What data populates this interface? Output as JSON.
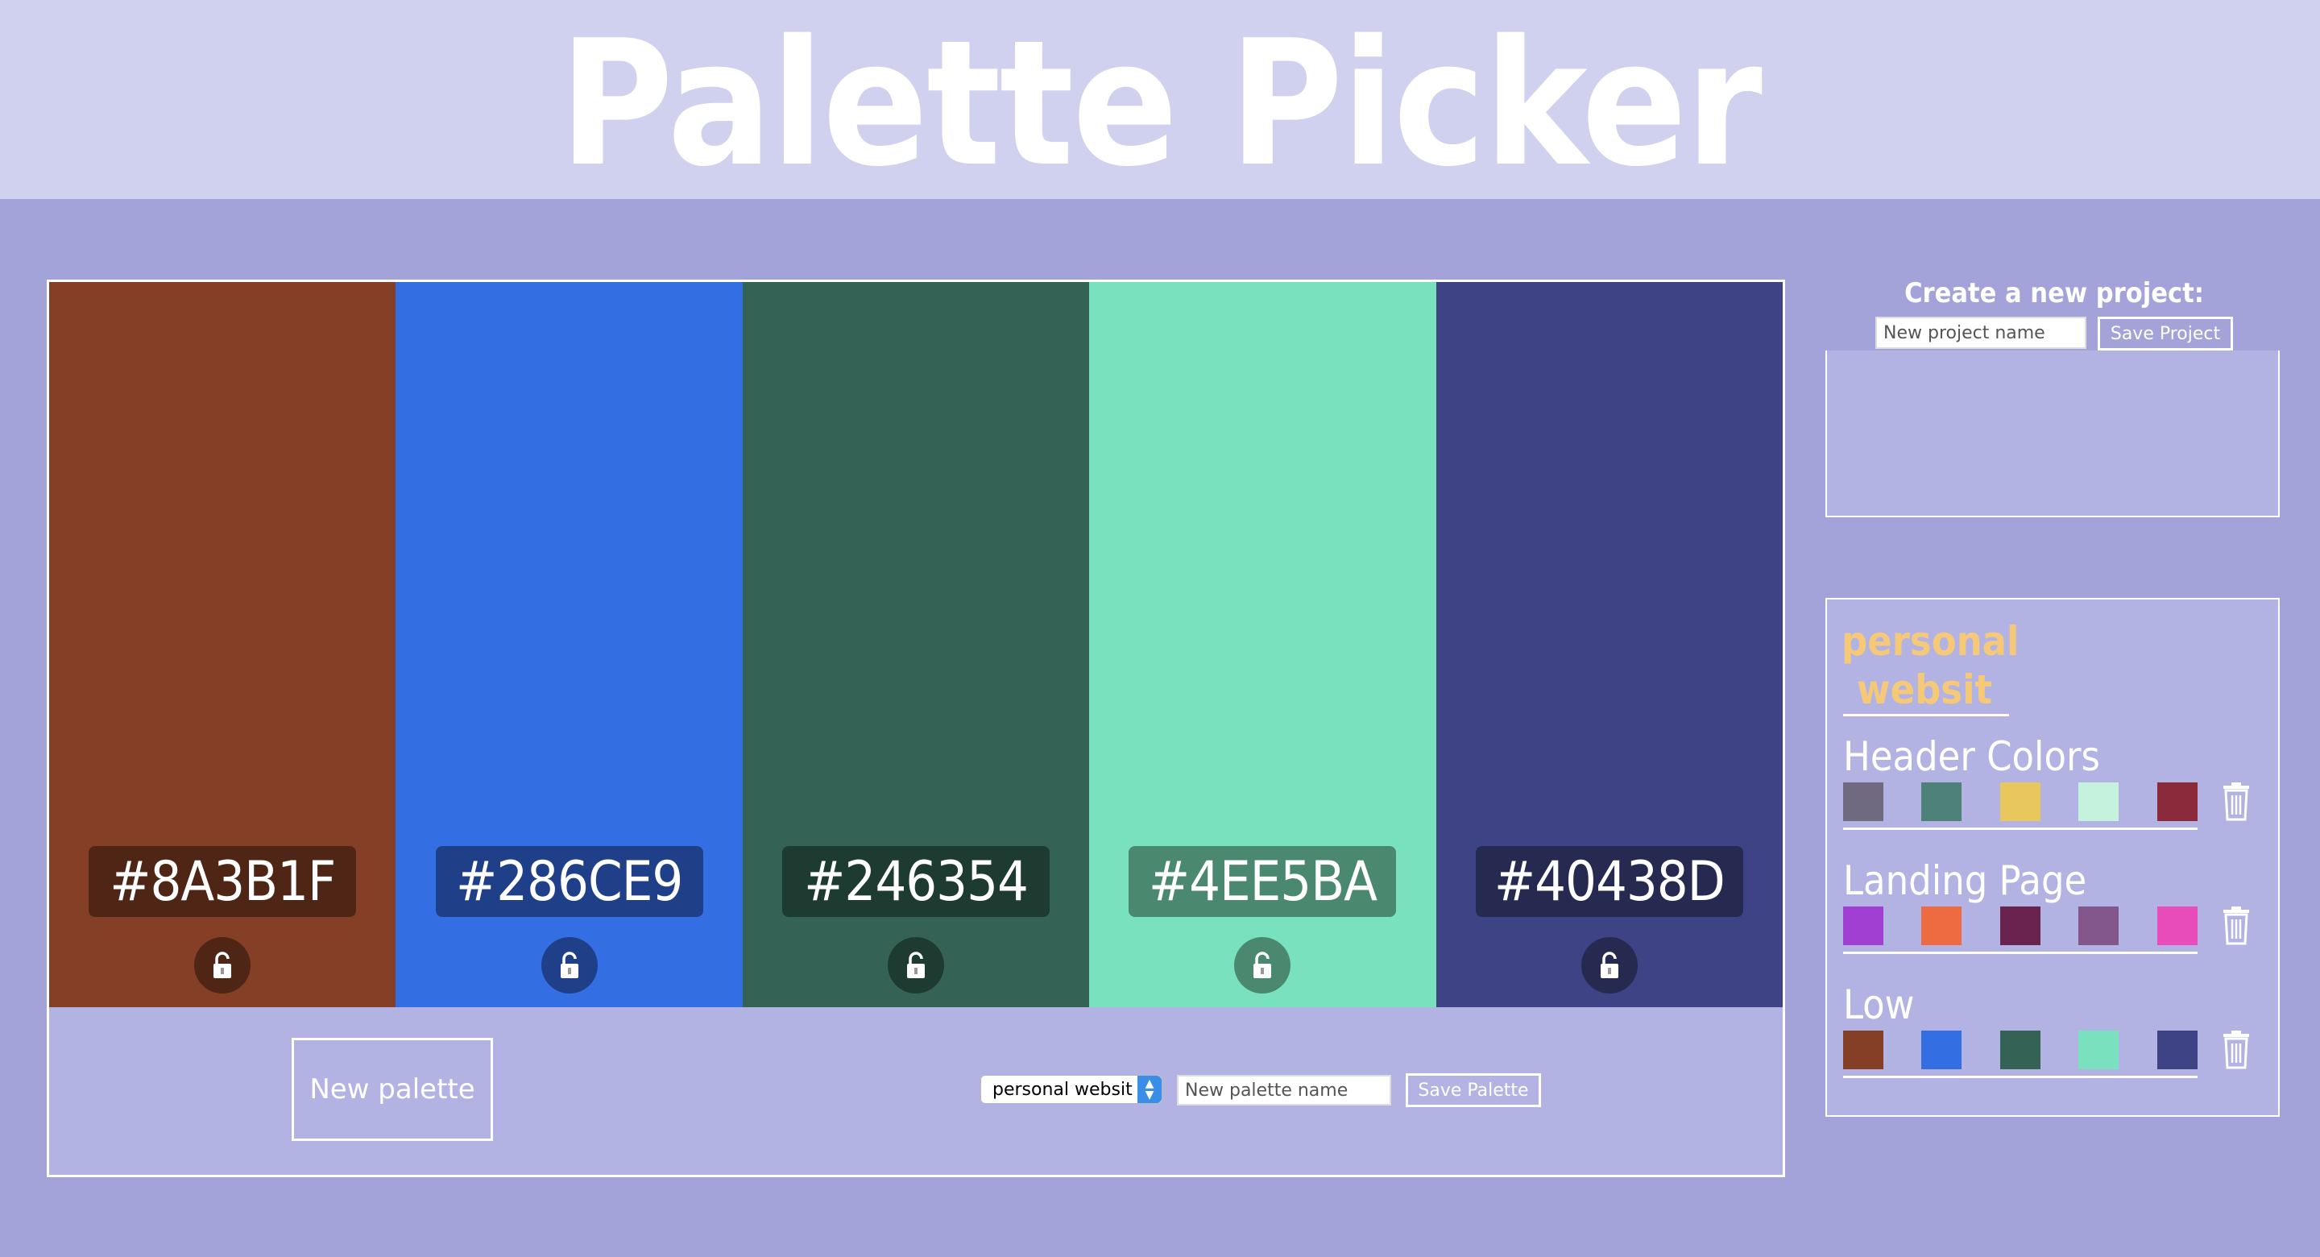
{
  "header": {
    "title": "Palette Picker"
  },
  "swatches": [
    {
      "hex": "#8A3B1F",
      "color": "#843f26",
      "label_bg": "#4f2615",
      "lock_bg": "#4f2615"
    },
    {
      "hex": "#286CE9",
      "color": "#336fe2",
      "label_bg": "#1f4088",
      "lock_bg": "#1f4088"
    },
    {
      "hex": "#246354",
      "color": "#346355",
      "label_bg": "#1e3b32",
      "lock_bg": "#1e3b32"
    },
    {
      "hex": "#4EE5BA",
      "color": "#7ae1be",
      "label_bg": "#4a8870",
      "lock_bg": "#4a8870"
    },
    {
      "hex": "#40438D",
      "color": "#3e4385",
      "label_bg": "#262950",
      "lock_bg": "#262950"
    }
  ],
  "controls": {
    "new_palette_label": "New palette",
    "project_select_value": "personal websit",
    "palette_name_placeholder": "New palette name",
    "save_palette_label": "Save Palette"
  },
  "sidebar": {
    "create_title": "Create a new project:",
    "project_name_placeholder": "New project name",
    "save_project_label": "Save Project",
    "project": {
      "name": "personal websit",
      "palettes": [
        {
          "name": "Header Colors",
          "colors": [
            "#6f6a80",
            "#4e8278",
            "#e8c85c",
            "#c4f2dc",
            "#8a2a3a"
          ]
        },
        {
          "name": "Landing Page",
          "colors": [
            "#a23fd3",
            "#ee6a40",
            "#68234f",
            "#83578b",
            "#e84bba"
          ]
        },
        {
          "name": "Low",
          "colors": [
            "#843f26",
            "#336fe2",
            "#346355",
            "#7ae1be",
            "#3e4385"
          ]
        }
      ]
    }
  }
}
